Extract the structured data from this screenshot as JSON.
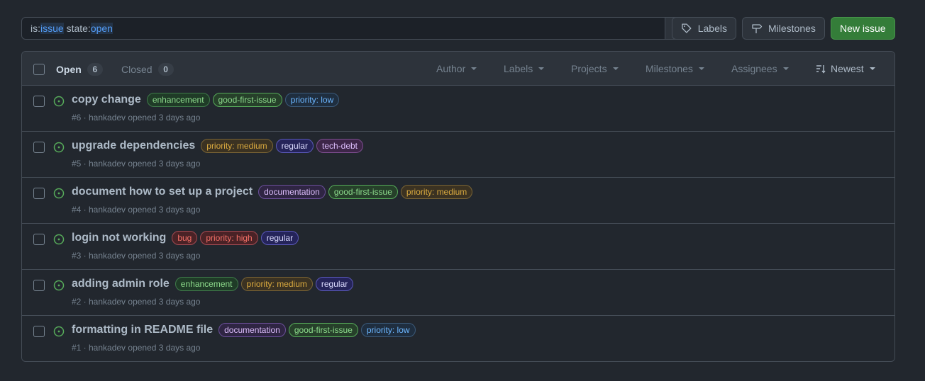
{
  "search": {
    "q_prefix1": "is:",
    "q_val1": "issue",
    "q_prefix2": " state:",
    "q_val2": "open"
  },
  "toolbar": {
    "labels": "Labels",
    "milestones": "Milestones",
    "new_issue": "New issue"
  },
  "header": {
    "open_label": "Open",
    "open_count": "6",
    "closed_label": "Closed",
    "closed_count": "0",
    "filters": [
      "Author",
      "Labels",
      "Projects",
      "Milestones",
      "Assignees"
    ],
    "sort": "Newest"
  },
  "label_colors": {
    "enhancement": {
      "bg": "#1f3b27",
      "border": "#3f7a4a",
      "fg": "#8ddb8c"
    },
    "good-first-issue": {
      "bg": "#26402a",
      "border": "#57ab5a",
      "fg": "#8ddb8c"
    },
    "priority: low": {
      "bg": "#1f2e3f",
      "border": "#3b5a7a",
      "fg": "#6cb6ff"
    },
    "priority: medium": {
      "bg": "#3b3222",
      "border": "#7a6435",
      "fg": "#daaa3f"
    },
    "priority: high": {
      "bg": "#4a2226",
      "border": "#a34a52",
      "fg": "#f47067"
    },
    "regular": {
      "bg": "#25245a",
      "border": "#5a58b8",
      "fg": "#dcdcff"
    },
    "tech-debt": {
      "bg": "#3d2648",
      "border": "#7d4d8f",
      "fg": "#dcbdfb"
    },
    "documentation": {
      "bg": "#2f2543",
      "border": "#6b4f9a",
      "fg": "#dcbdfb"
    },
    "bug": {
      "bg": "#4a2226",
      "border": "#a34a52",
      "fg": "#f47067"
    }
  },
  "issues": [
    {
      "title": "copy change",
      "labels": [
        "enhancement",
        "good-first-issue",
        "priority: low"
      ],
      "meta": "#6 · hankadev opened 3 days ago"
    },
    {
      "title": "upgrade dependencies",
      "labels": [
        "priority: medium",
        "regular",
        "tech-debt"
      ],
      "meta": "#5 · hankadev opened 3 days ago"
    },
    {
      "title": "document how to set up a project",
      "labels": [
        "documentation",
        "good-first-issue",
        "priority: medium"
      ],
      "meta": "#4 · hankadev opened 3 days ago"
    },
    {
      "title": "login not working",
      "labels": [
        "bug",
        "priority: high",
        "regular"
      ],
      "meta": "#3 · hankadev opened 3 days ago"
    },
    {
      "title": "adding admin role",
      "labels": [
        "enhancement",
        "priority: medium",
        "regular"
      ],
      "meta": "#2 · hankadev opened 3 days ago"
    },
    {
      "title": "formatting in README file",
      "labels": [
        "documentation",
        "good-first-issue",
        "priority: low"
      ],
      "meta": "#1 · hankadev opened 3 days ago"
    }
  ]
}
